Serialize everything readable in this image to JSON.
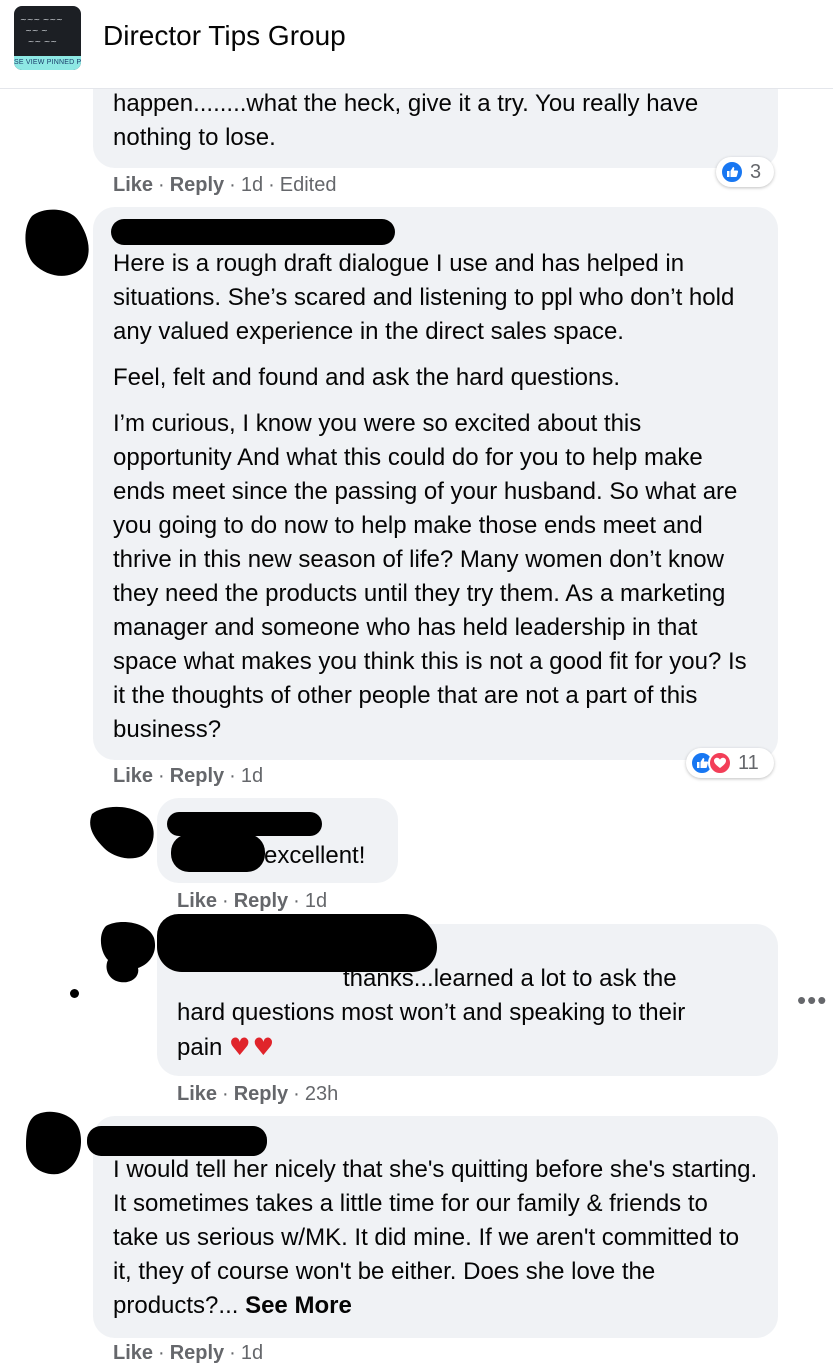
{
  "header": {
    "group_name": "Director Tips Group",
    "thumb_band_text": "SE VIEW PINNED P"
  },
  "colors": {
    "bubble": "#f0f2f5",
    "meta": "#65676b",
    "like_blue": "#1877f2",
    "love_red": "#f33e58"
  },
  "comments": [
    {
      "paragraphs": [
        "happen........what the heck, give it a try. You really have nothing to lose."
      ],
      "meta": {
        "like": "Like",
        "reply": "Reply",
        "time": "1d",
        "extra": "Edited"
      },
      "reactions": {
        "icons": [
          "like-icon"
        ],
        "count": "3"
      }
    },
    {
      "paragraphs": [
        "Here is a rough draft dialogue I use and has helped in situations. She’s scared and listening to ppl who don’t hold any valued experience in the direct sales space.",
        "Feel, felt and found and ask the hard questions.",
        "I’m curious, I know you were so excited about this opportunity And what this could do for you to help make ends meet since the passing of your husband. So what are you going to do now to help make those ends meet and thrive in this new season of life? Many women don’t know they need the products until they try them. As a marketing manager and someone who has held leadership in that space what makes you think this is not a good fit for you? Is it the thoughts of other people that are not a part of this business?"
      ],
      "meta": {
        "like": "Like",
        "reply": "Reply",
        "time": "1d"
      },
      "reactions": {
        "icons": [
          "like-icon",
          "love-icon"
        ],
        "count": "11"
      }
    },
    {
      "paragraphs": [
        "excellent!"
      ],
      "meta": {
        "like": "Like",
        "reply": "Reply",
        "time": "1d"
      }
    },
    {
      "paragraphs": [
        "thanks...learned a lot to ask the",
        "hard questions most won’t and speaking to their",
        "pain"
      ],
      "emoji": "♥♥",
      "meta": {
        "like": "Like",
        "reply": "Reply",
        "time": "23h"
      }
    },
    {
      "paragraphs": [
        "I would tell her nicely that she's quitting before she's starting. It sometimes takes a little time for our family & friends to take us serious w/MK. It did mine. If we aren't committed to it, they of course won't be either. Does she love the products?..."
      ],
      "see_more": "See More",
      "meta": {
        "like": "Like",
        "reply": "Reply",
        "time": "1d"
      }
    }
  ],
  "more_options": "•••"
}
